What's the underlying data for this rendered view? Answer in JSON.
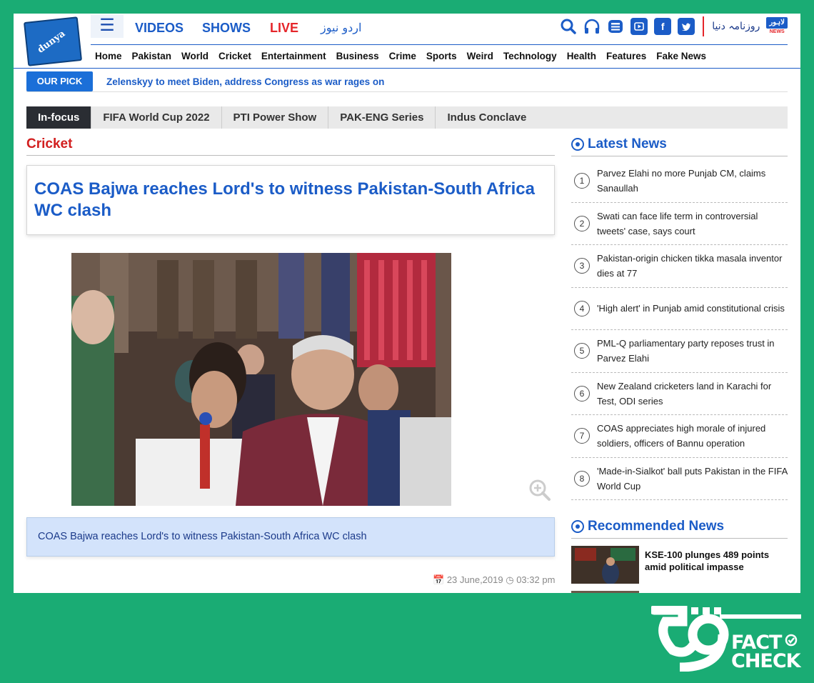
{
  "header": {
    "logo_text": "dunya",
    "menu_icon": "hamburger-icon",
    "top_nav": [
      {
        "label": "VIDEOS"
      },
      {
        "label": "SHOWS"
      },
      {
        "label": "LIVE"
      },
      {
        "label": "اردو نیوز"
      }
    ],
    "brand_urdu": "روزنامہ دنیا",
    "brand_lahore": "لاہور",
    "brand_news": "NEWS",
    "icons": [
      "search-icon",
      "headphones-icon",
      "newspaper-icon",
      "youtube-icon",
      "facebook-icon",
      "twitter-icon"
    ],
    "main_nav": [
      "Home",
      "Pakistan",
      "World",
      "Cricket",
      "Entertainment",
      "Business",
      "Crime",
      "Sports",
      "Weird",
      "Technology",
      "Health",
      "Features",
      "Fake News"
    ]
  },
  "our_pick": {
    "label": "OUR PICK",
    "text": "Zelenskyy to meet Biden, address Congress as war rages on"
  },
  "tabs": [
    "In-focus",
    "FIFA World Cup 2022",
    "PTI Power Show",
    "PAK-ENG Series",
    "Indus Conclave"
  ],
  "article": {
    "section": "Cricket",
    "title": "COAS Bajwa reaches Lord's to witness Pakistan-South Africa WC clash",
    "caption": "COAS Bajwa reaches Lord's to witness Pakistan-South Africa WC clash",
    "date": "23 June,2019",
    "time": "03:32 pm"
  },
  "latest": {
    "heading": "Latest News",
    "items": [
      {
        "num": "1",
        "text": "Parvez Elahi no more Punjab CM, claims Sanaullah"
      },
      {
        "num": "2",
        "text": "Swati can face life term in controversial tweets' case, says court"
      },
      {
        "num": "3",
        "text": "Pakistan-origin chicken tikka masala inventor dies at 77"
      },
      {
        "num": "4",
        "text": "'High alert' in Punjab amid constitutional crisis"
      },
      {
        "num": "5",
        "text": "PML-Q parliamentary party reposes trust in Parvez Elahi"
      },
      {
        "num": "6",
        "text": "New Zealand cricketers land in Karachi for Test, ODI series"
      },
      {
        "num": "7",
        "text": "COAS appreciates high morale of injured soldiers, officers of Bannu operation"
      },
      {
        "num": "8",
        "text": "'Made-in-Sialkot' ball puts Pakistan in the FIFA World Cup"
      }
    ]
  },
  "recommended": {
    "heading": "Recommended News",
    "items": [
      {
        "text": "KSE-100 plunges 489 points amid political impasse"
      }
    ]
  },
  "watermark": {
    "line1": "FACT",
    "line2": "CHECK",
    "number": "69"
  },
  "colors": {
    "background": "#1aac74",
    "accent": "#1b5cc7",
    "red": "#d21f1f",
    "live": "#e5252a"
  }
}
